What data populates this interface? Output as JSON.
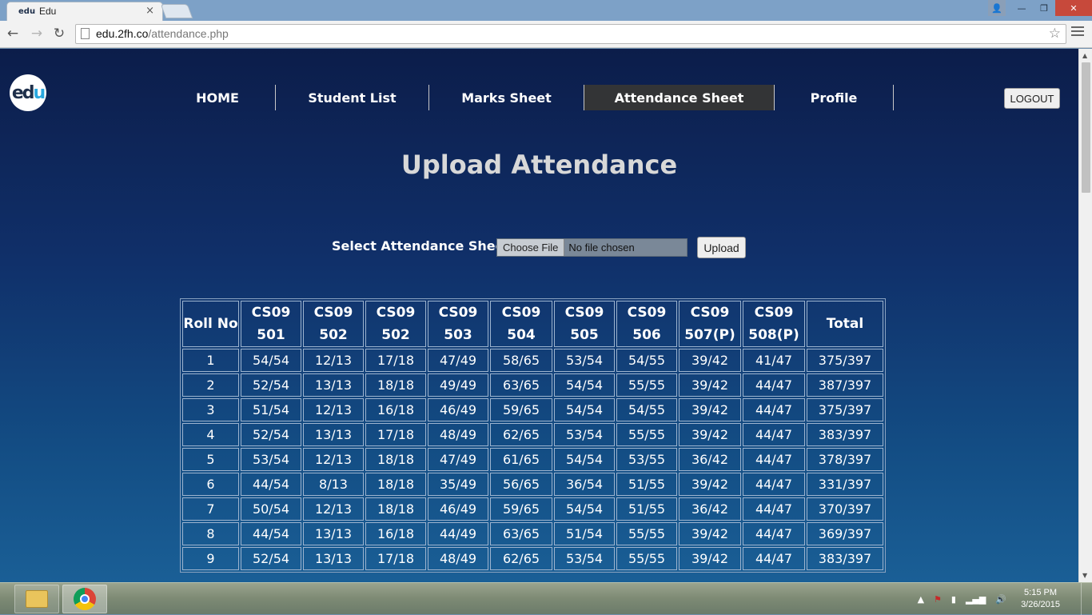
{
  "browser": {
    "tab_title": "Edu",
    "tab_favicon": "edu",
    "tab_close": "×",
    "url_host": "edu.2fh.co",
    "url_path": "/attendance.php",
    "back": "←",
    "forward": "→",
    "reload": "↻",
    "star": "☆",
    "window_user": "👤",
    "window_min": "—",
    "window_max": "❐",
    "window_close": "✕"
  },
  "header": {
    "logo_e": "ed",
    "logo_u": "u",
    "nav": [
      {
        "label": "HOME"
      },
      {
        "label": "Student List"
      },
      {
        "label": "Marks Sheet"
      },
      {
        "label": "Attendance Sheet",
        "active": true
      },
      {
        "label": "Profile"
      }
    ],
    "logout_label": "LOGOUT"
  },
  "main": {
    "title": "Upload Attendance",
    "upload": {
      "label": "Select Attendance Sheet",
      "choose_file": "Choose File",
      "no_file": "No file chosen",
      "button": "Upload"
    },
    "table": {
      "headers": [
        [
          "Roll No"
        ],
        [
          "CS09",
          "501"
        ],
        [
          "CS09",
          "502"
        ],
        [
          "CS09",
          "502"
        ],
        [
          "CS09",
          "503"
        ],
        [
          "CS09",
          "504"
        ],
        [
          "CS09",
          "505"
        ],
        [
          "CS09",
          "506"
        ],
        [
          "CS09",
          "507(P)"
        ],
        [
          "CS09",
          "508(P)"
        ],
        [
          "Total"
        ]
      ],
      "rows": [
        [
          "1",
          "54/54",
          "12/13",
          "17/18",
          "47/49",
          "58/65",
          "53/54",
          "54/55",
          "39/42",
          "41/47",
          "375/397"
        ],
        [
          "2",
          "52/54",
          "13/13",
          "18/18",
          "49/49",
          "63/65",
          "54/54",
          "55/55",
          "39/42",
          "44/47",
          "387/397"
        ],
        [
          "3",
          "51/54",
          "12/13",
          "16/18",
          "46/49",
          "59/65",
          "54/54",
          "54/55",
          "39/42",
          "44/47",
          "375/397"
        ],
        [
          "4",
          "52/54",
          "13/13",
          "17/18",
          "48/49",
          "62/65",
          "53/54",
          "55/55",
          "39/42",
          "44/47",
          "383/397"
        ],
        [
          "5",
          "53/54",
          "12/13",
          "18/18",
          "47/49",
          "61/65",
          "54/54",
          "53/55",
          "36/42",
          "44/47",
          "378/397"
        ],
        [
          "6",
          "44/54",
          "8/13",
          "18/18",
          "35/49",
          "56/65",
          "36/54",
          "51/55",
          "39/42",
          "44/47",
          "331/397"
        ],
        [
          "7",
          "50/54",
          "12/13",
          "18/18",
          "46/49",
          "59/65",
          "54/54",
          "51/55",
          "36/42",
          "44/47",
          "370/397"
        ],
        [
          "8",
          "44/54",
          "13/13",
          "16/18",
          "44/49",
          "63/65",
          "51/54",
          "55/55",
          "39/42",
          "44/47",
          "369/397"
        ],
        [
          "9",
          "52/54",
          "13/13",
          "17/18",
          "48/49",
          "62/65",
          "53/54",
          "55/55",
          "39/42",
          "44/47",
          "383/397"
        ]
      ]
    }
  },
  "taskbar": {
    "clock_time": "5:15 PM",
    "clock_date": "3/26/2015",
    "tray_arrow": "▲",
    "tray_flag": "⚑",
    "tray_battery": "▮",
    "tray_signal": "▂▄▆",
    "tray_volume": "🔊"
  }
}
